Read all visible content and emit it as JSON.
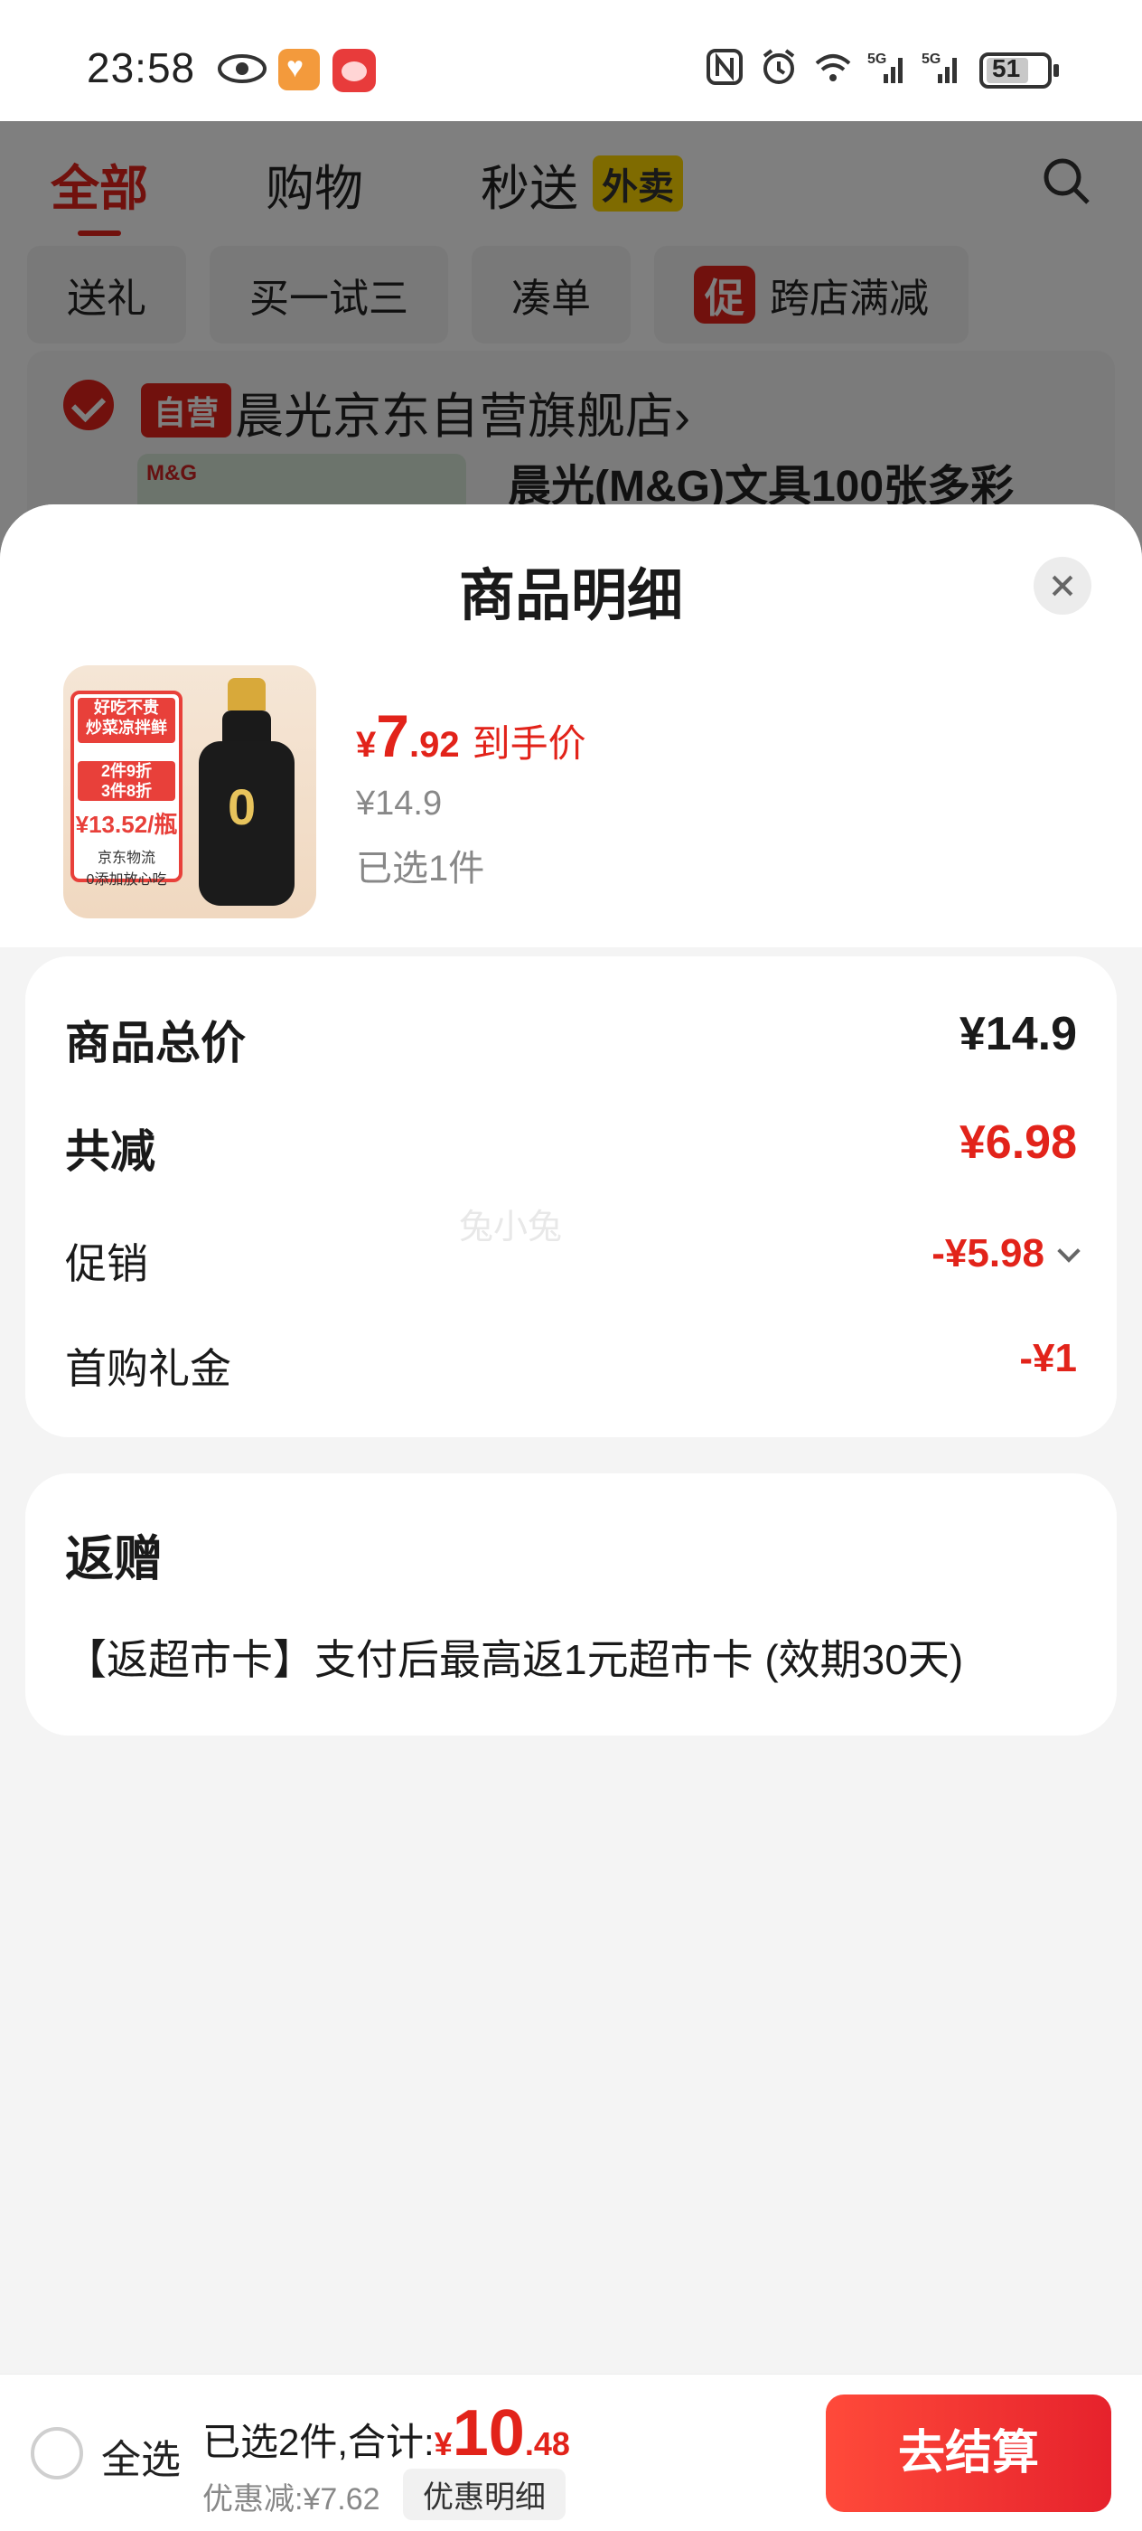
{
  "status_bar": {
    "time": "23:58",
    "battery": "51",
    "icons": [
      "eye-icon",
      "health-app-icon",
      "shop-app-icon",
      "nfc-icon",
      "alarm-icon",
      "wifi-icon",
      "signal-5g-icon",
      "signal-5g-icon",
      "battery-icon"
    ]
  },
  "background": {
    "tabs": [
      "全部",
      "购物",
      "秒送"
    ],
    "waimai_badge": "外卖",
    "chips": [
      "送礼",
      "买一试三",
      "凑单",
      "跨店满减"
    ],
    "promo_tag": "促",
    "store_tag": "自营",
    "store_name": "晨光京东自营旗舰店",
    "store_chevron": "›",
    "product_title": "晨光(M&G)文具100张多彩",
    "product_thumb_brand": "M&G"
  },
  "sheet": {
    "title": "商品明细",
    "product": {
      "currency": "¥",
      "price_int": "7",
      "price_dec": ".92",
      "price_label": "到手价",
      "original_price": "¥14.9",
      "selected_count": "已选1件",
      "image_texts": {
        "line1": "好吃不贵",
        "line2": "炒菜凉拌鲜",
        "line3": "2件9折",
        "line4": "3件8折",
        "price": "¥13.52/瓶",
        "logistics": "京东物流",
        "additive": "0添加放心吃",
        "bottle_zero": "0"
      }
    },
    "breakdown": {
      "total_label": "商品总价",
      "total_value": "¥14.9",
      "reduce_label": "共减",
      "reduce_value": "¥6.98",
      "promo_label": "促销",
      "promo_value": "-¥5.98",
      "gift_label": "首购礼金",
      "gift_value": "-¥1"
    },
    "watermark": "兔小兔",
    "rebate": {
      "title": "返赠",
      "desc": "【返超市卡】支付后最高返1元超市卡 (效期30天)"
    }
  },
  "bottom_bar": {
    "select_all": "全选",
    "summary_prefix": "已选2件,合计:",
    "currency": "¥",
    "total_int": "10",
    "total_dec": ".48",
    "discount": "优惠减:¥7.62",
    "discount_detail": "优惠明细",
    "checkout": "去结算"
  },
  "colors": {
    "accent": "#e2231a",
    "overlay": "rgba(0,0,0,0.5)",
    "sheet_bg": "#f4f4f4"
  }
}
